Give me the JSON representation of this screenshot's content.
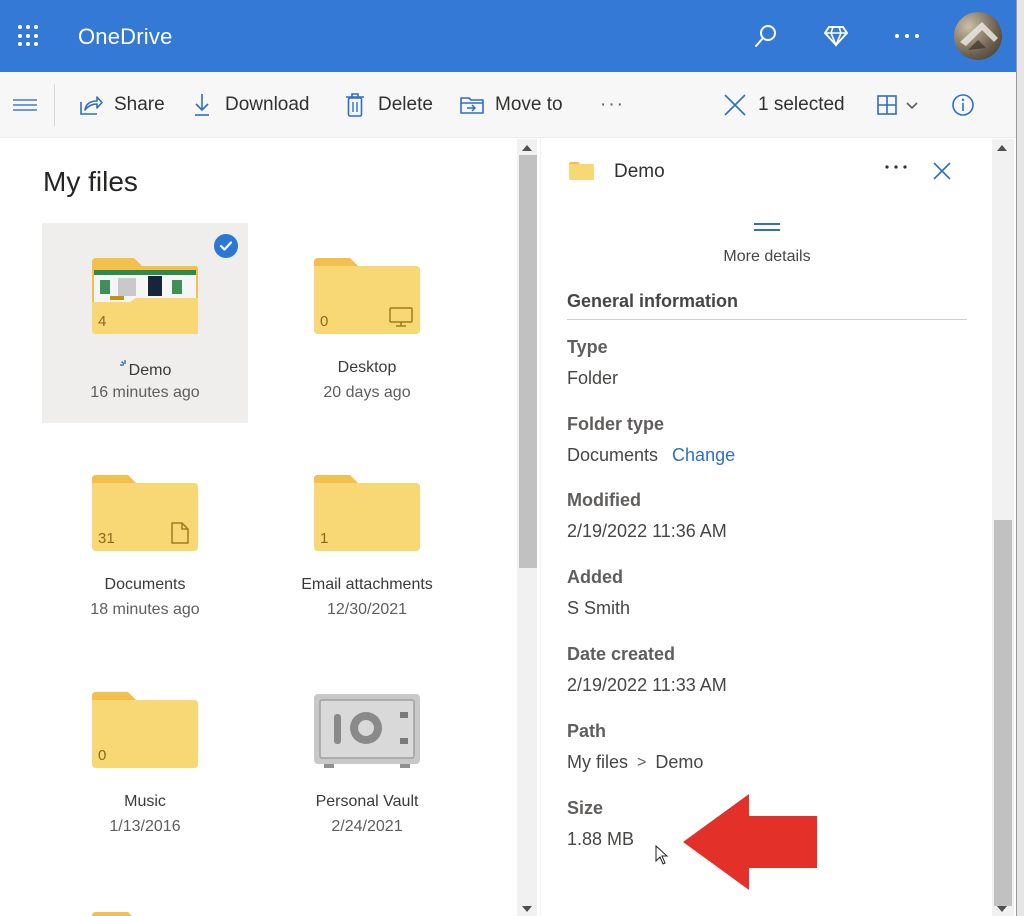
{
  "app": {
    "title": "OneDrive",
    "icons": [
      "waffle-icon",
      "search-icon",
      "premium-diamond-icon",
      "more-icon",
      "avatar"
    ]
  },
  "colors": {
    "suite_bar": "#3579d6",
    "accent": "#2b78d4",
    "link": "#2f6fc2",
    "folder": "#f8d775",
    "annotation_arrow": "#e3312a"
  },
  "command_bar": {
    "share": "Share",
    "download": "Download",
    "delete": "Delete",
    "move_to": "Move to",
    "more": "···",
    "selection_count": "1 selected"
  },
  "files": {
    "title": "My files",
    "items": [
      {
        "name": "Demo",
        "date": "16 minutes ago",
        "count": "4",
        "kind": "folder-with-preview",
        "selected": true,
        "syncing": true
      },
      {
        "name": "Desktop",
        "date": "20 days ago",
        "count": "0",
        "kind": "folder-desktop"
      },
      {
        "name": "Documents",
        "date": "18 minutes ago",
        "count": "31",
        "kind": "folder-documents"
      },
      {
        "name": "Email attachments",
        "date": "12/30/2021",
        "count": "1",
        "kind": "folder"
      },
      {
        "name": "Music",
        "date": "1/13/2016",
        "count": "0",
        "kind": "folder"
      },
      {
        "name": "Personal Vault",
        "date": "2/24/2021",
        "count": "",
        "kind": "vault"
      }
    ]
  },
  "details": {
    "title": "Demo",
    "more_details": "More details",
    "section": "General information",
    "props": {
      "type": {
        "label": "Type",
        "value": "Folder"
      },
      "folder_type": {
        "label": "Folder type",
        "value": "Documents",
        "action": "Change"
      },
      "modified": {
        "label": "Modified",
        "value": "2/19/2022 11:36 AM"
      },
      "added": {
        "label": "Added",
        "value": "S Smith"
      },
      "created": {
        "label": "Date created",
        "value": "2/19/2022 11:33 AM"
      },
      "path": {
        "label": "Path",
        "root": "My files",
        "separator": ">",
        "leaf": "Demo"
      },
      "size": {
        "label": "Size",
        "value": "1.88 MB"
      }
    }
  }
}
